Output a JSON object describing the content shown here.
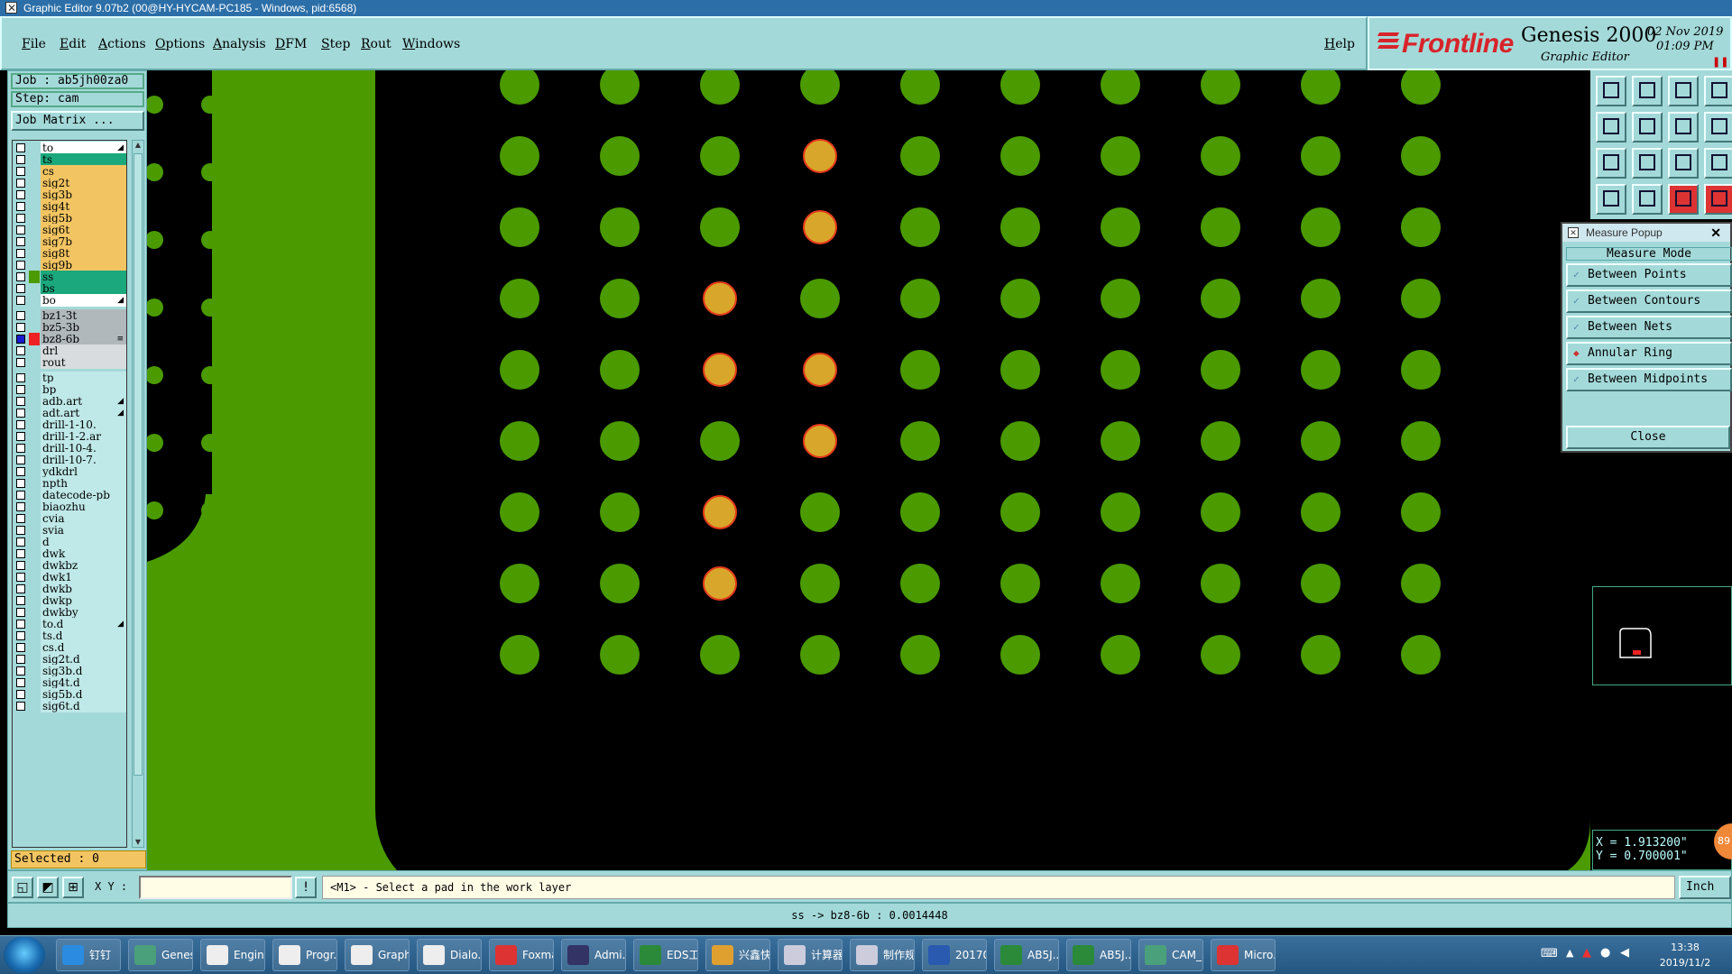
{
  "window": {
    "title": "Graphic Editor 9.07b2 (00@HY-HYCAM-PC185 - Windows, pid:6568)"
  },
  "menubar": {
    "items": [
      "File",
      "Edit",
      "Actions",
      "Options",
      "Analysis",
      "DFM",
      "Step",
      "Rout",
      "Windows"
    ],
    "help": "Help"
  },
  "logo": {
    "brand": "Frontline",
    "product": "Genesis 2000",
    "subtitle": "Graphic Editor",
    "date": "02 Nov 2019",
    "time": "01:09 PM"
  },
  "job": {
    "job_label": "Job : ab5jh00za0",
    "step_label": "Step: cam",
    "matrix_button": "Job Matrix ..."
  },
  "layers": [
    {
      "name": "to",
      "color": "#ffffff",
      "arrow": true
    },
    {
      "name": "ts",
      "color": "#1aa87c"
    },
    {
      "name": "cs",
      "color": "#f3c562"
    },
    {
      "name": "sig2t",
      "color": "#f3c562"
    },
    {
      "name": "sig3b",
      "color": "#f3c562"
    },
    {
      "name": "sig4t",
      "color": "#f3c562"
    },
    {
      "name": "sig5b",
      "color": "#f3c562"
    },
    {
      "name": "sig6t",
      "color": "#f3c562"
    },
    {
      "name": "sig7b",
      "color": "#f3c562"
    },
    {
      "name": "sig8t",
      "color": "#f3c562"
    },
    {
      "name": "sig9b",
      "color": "#f3c562"
    },
    {
      "name": "ss",
      "color": "#1aa87c",
      "swatch": "#4a9a00"
    },
    {
      "name": "bs",
      "color": "#1aa87c"
    },
    {
      "name": "bo",
      "color": "#ffffff",
      "arrow": true
    },
    {
      "name": "bz1-3t",
      "color": "#b0b8bc",
      "gap": true
    },
    {
      "name": "bz5-3b",
      "color": "#b0b8bc"
    },
    {
      "name": "bz8-6b",
      "color": "#b0b8bc",
      "swatch": "#e22",
      "box": "#1a1ad0",
      "mark": "≡"
    },
    {
      "name": "drl",
      "color": "#d8dcde"
    },
    {
      "name": "rout",
      "color": "#d8dcde"
    },
    {
      "name": "tp",
      "color": "#bfe8e8",
      "gap": true
    },
    {
      "name": "bp",
      "color": "#bfe8e8"
    },
    {
      "name": "adb.art",
      "color": "#bfe8e8",
      "arrow": true
    },
    {
      "name": "adt.art",
      "color": "#bfe8e8",
      "arrow": true
    },
    {
      "name": "drill-1-10.",
      "color": "#bfe8e8"
    },
    {
      "name": "drill-1-2.ar",
      "color": "#bfe8e8"
    },
    {
      "name": "drill-10-4.",
      "color": "#bfe8e8"
    },
    {
      "name": "drill-10-7.",
      "color": "#bfe8e8"
    },
    {
      "name": "ydkdrl",
      "color": "#bfe8e8"
    },
    {
      "name": "npth",
      "color": "#bfe8e8"
    },
    {
      "name": "datecode-pb",
      "color": "#bfe8e8"
    },
    {
      "name": "biaozhu",
      "color": "#bfe8e8"
    },
    {
      "name": "cvia",
      "color": "#bfe8e8"
    },
    {
      "name": "svia",
      "color": "#bfe8e8"
    },
    {
      "name": "d",
      "color": "#bfe8e8"
    },
    {
      "name": "dwk",
      "color": "#bfe8e8"
    },
    {
      "name": "dwkbz",
      "color": "#bfe8e8"
    },
    {
      "name": "dwk1",
      "color": "#bfe8e8"
    },
    {
      "name": "dwkb",
      "color": "#bfe8e8"
    },
    {
      "name": "dwkp",
      "color": "#bfe8e8"
    },
    {
      "name": "dwkby",
      "color": "#bfe8e8"
    },
    {
      "name": "to.d",
      "color": "#bfe8e8",
      "arrow": true
    },
    {
      "name": "ts.d",
      "color": "#bfe8e8"
    },
    {
      "name": "cs.d",
      "color": "#bfe8e8"
    },
    {
      "name": "sig2t.d",
      "color": "#bfe8e8"
    },
    {
      "name": "sig3b.d",
      "color": "#bfe8e8"
    },
    {
      "name": "sig4t.d",
      "color": "#bfe8e8"
    },
    {
      "name": "sig5b.d",
      "color": "#bfe8e8"
    },
    {
      "name": "sig6t.d",
      "color": "#bfe8e8"
    }
  ],
  "selected_label": "Selected : 0",
  "colors": {
    "pad_green": "#4a9a00",
    "pad_selected": "#d8a62a",
    "pad_outline": "#e53a1a",
    "panel": "#a4d9d9"
  },
  "pads": {
    "selected": [
      [
        3,
        1
      ],
      [
        3,
        2
      ],
      [
        2,
        3
      ],
      [
        2,
        4
      ],
      [
        3,
        4
      ],
      [
        3,
        5
      ],
      [
        2,
        6
      ],
      [
        2,
        7
      ]
    ]
  },
  "measure_popup": {
    "title": "Measure Popup",
    "mode_title": "Measure Mode",
    "options": [
      {
        "label": "Between Points",
        "checked": false
      },
      {
        "label": "Between Contours",
        "checked": false
      },
      {
        "label": "Between Nets",
        "checked": false
      },
      {
        "label": "Annular Ring",
        "checked": true
      },
      {
        "label": "Between Midpoints",
        "checked": false
      }
    ],
    "close_label": "Close"
  },
  "coords": {
    "x": "X = 1.913200\"",
    "y": "Y = 0.700001\""
  },
  "badge": "89",
  "input": {
    "xy_label": "X Y :",
    "xy_value": "",
    "prompt": "<M1> - Select a pad in the work layer",
    "units": "Inch"
  },
  "status": "ss -> bz8-6b : 0.0014448",
  "taskbar": {
    "items": [
      {
        "label": "钉钉",
        "color": "#2a8be0"
      },
      {
        "label": "Genesis",
        "color": "#4aa07a"
      },
      {
        "label": "Engin...",
        "color": "#eee"
      },
      {
        "label": "Progr...",
        "color": "#eee"
      },
      {
        "label": "Graph...",
        "color": "#eee"
      },
      {
        "label": "Dialo...",
        "color": "#eee"
      },
      {
        "label": "Foxmail",
        "color": "#d33"
      },
      {
        "label": "Admi...",
        "color": "#336"
      },
      {
        "label": "EDS工...",
        "color": "#2a8a3a"
      },
      {
        "label": "兴鑫快...",
        "color": "#e0a030"
      },
      {
        "label": "计算器",
        "color": "#ccd"
      },
      {
        "label": "制作规...",
        "color": "#ccd"
      },
      {
        "label": "20170...",
        "color": "#2a5ab0"
      },
      {
        "label": "AB5J...",
        "color": "#2a8a3a"
      },
      {
        "label": "AB5J...",
        "color": "#2a8a3a"
      },
      {
        "label": "CAM_...",
        "color": "#4aa07a"
      },
      {
        "label": "Micro...",
        "color": "#d33"
      }
    ],
    "time": "13:38",
    "date": "2019/11/2"
  }
}
